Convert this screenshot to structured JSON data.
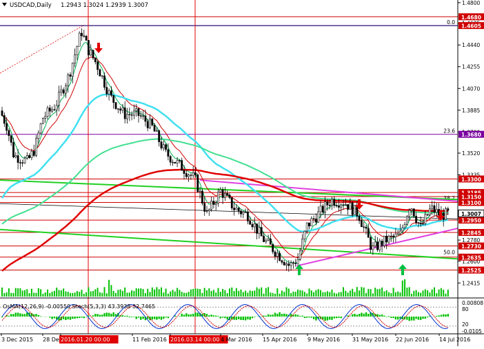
{
  "window": {
    "symbol": "USDCAD,Daily",
    "ohlc": "1.2943 1.3024 1.2939 1.3007"
  },
  "chart_data": {
    "type": "candlestick",
    "ylim": [
      1.2405,
      1.4805
    ],
    "price_ticks": [
      {
        "label": "1.4800",
        "value": 1.48
      },
      {
        "label": "1.4625",
        "value": 1.4625
      },
      {
        "label": "1.4440",
        "value": 1.444
      },
      {
        "label": "1.4255",
        "value": 1.4255
      },
      {
        "label": "1.4070",
        "value": 1.407
      },
      {
        "label": "1.3885",
        "value": 1.3885
      },
      {
        "label": "1.3700",
        "value": 1.37
      },
      {
        "label": "1.3520",
        "value": 1.352
      },
      {
        "label": "1.3335",
        "value": 1.3335
      },
      {
        "label": "1.3150",
        "value": 1.315
      },
      {
        "label": "1.2965",
        "value": 1.2965
      },
      {
        "label": "1.2780",
        "value": 1.278
      },
      {
        "label": "1.2600",
        "value": 1.26
      },
      {
        "label": "1.2415",
        "value": 1.2415
      }
    ],
    "levels": [
      {
        "label": "1.4680",
        "value": 1.468,
        "color": "#d00000"
      },
      {
        "label": "1.4605",
        "value": 1.4605,
        "color": "#d00000"
      },
      {
        "label": "1.3680",
        "value": 1.368,
        "color": "#7a00a0"
      },
      {
        "label": "1.3300",
        "value": 1.33,
        "color": "#d00000"
      },
      {
        "label": "1.3185",
        "value": 1.3185,
        "color": "#d00000"
      },
      {
        "label": "1.3150",
        "value": 1.315,
        "color": "#d00000"
      },
      {
        "label": "1.3100",
        "value": 1.31,
        "color": "#d00000"
      },
      {
        "label": "1.2950",
        "value": 1.295,
        "color": "#d00000"
      },
      {
        "label": "1.2845",
        "value": 1.2845,
        "color": "#d00000"
      },
      {
        "label": "1.2730",
        "value": 1.273,
        "color": "#d00000"
      },
      {
        "label": "1.2635",
        "value": 1.2635,
        "color": "#d00000"
      },
      {
        "label": "1.2525",
        "value": 1.2525,
        "color": "#d00000"
      }
    ],
    "current_price": {
      "label": "1.3007",
      "value": 1.3007
    },
    "fib_levels": [
      {
        "label": "0.0",
        "value": 1.4605
      },
      {
        "label": "23.6",
        "value": 1.368
      },
      {
        "label": "38.2",
        "value": 1.3108
      },
      {
        "label": "50.0",
        "value": 1.2648
      }
    ],
    "date_labels": [
      "3 Dec 2015",
      "28 Dec 2015",
      "2016.01.20 00:00",
      "11 Feb 2016",
      "2016.03.14 00:00",
      "4 Mar 2016",
      "15 Apr 2016",
      "9 May 2016",
      "31 May 2016",
      "22 Jun 2016",
      "14 Jul 2016"
    ],
    "highlighted_dates": [
      "2016.01.20 00:00",
      "2016.03.14 00:00"
    ],
    "indicator": {
      "label": "OsMA(12,26,9) -0.00550 Stoch(5,3,3) 43.3938 32.7465",
      "ticks": [
        "0.00808",
        "80",
        "20",
        "-0.0105"
      ]
    },
    "signal_arrows": [
      {
        "direction": "down",
        "color": "#e00000"
      },
      {
        "direction": "down",
        "color": "#e00000"
      },
      {
        "direction": "down",
        "color": "#e00000"
      },
      {
        "direction": "up",
        "color": "#00c040"
      },
      {
        "direction": "up",
        "color": "#00c040"
      }
    ],
    "colors": {
      "bull_candle": "#000000",
      "bear_candle": "#000000",
      "ema_fast": "#00b050",
      "ema_slow": "#d00000",
      "ema_200": "#e00000",
      "ema_144": "#40e090",
      "ema_50": "#40e0f0",
      "trend_green": "#20d020",
      "trend_magenta": "#e040e0",
      "grid_red": "#e00000",
      "histogram": "#00c000"
    }
  }
}
